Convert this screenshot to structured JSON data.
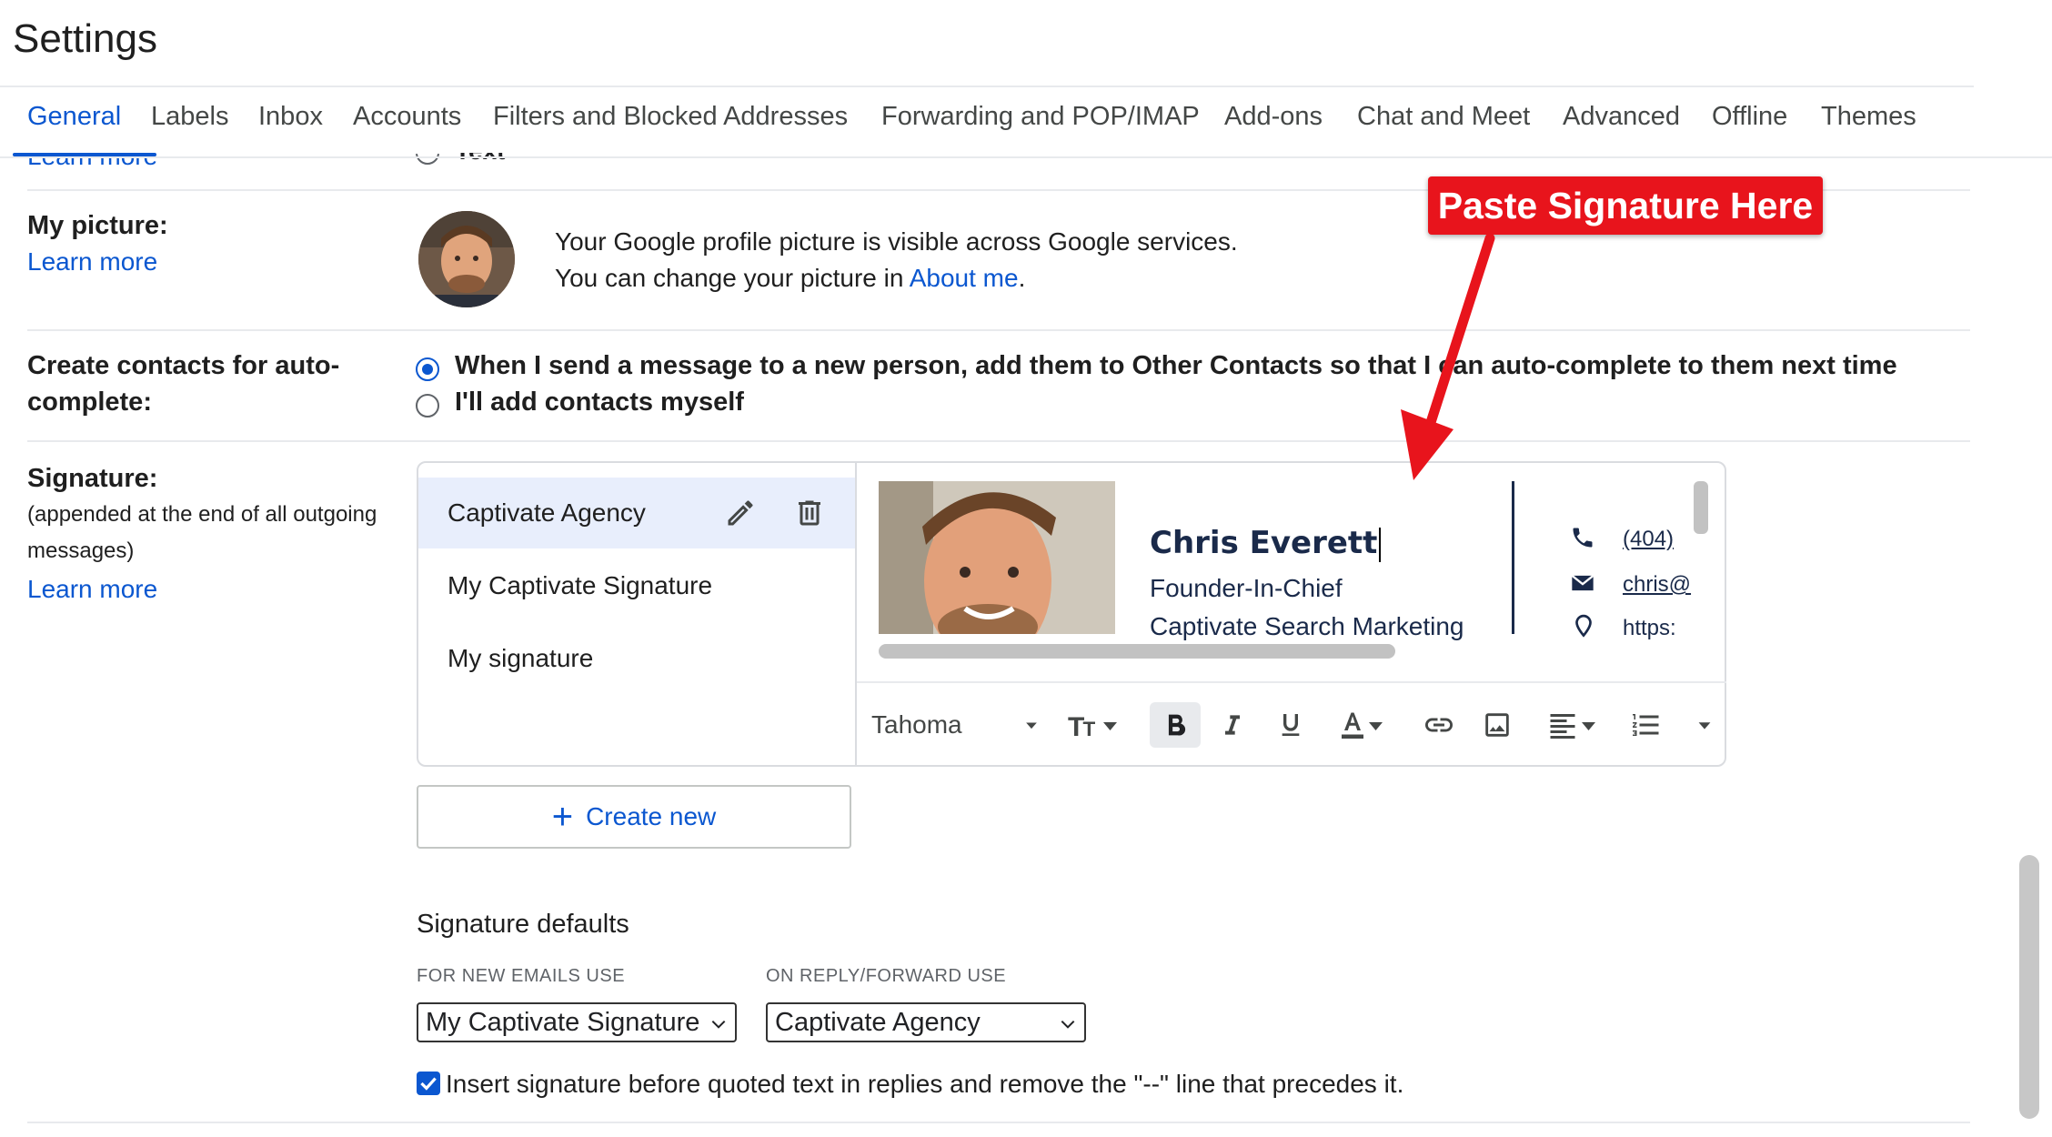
{
  "header": {
    "title": "Settings"
  },
  "tabs": [
    {
      "label": "General",
      "active": true
    },
    {
      "label": "Labels"
    },
    {
      "label": "Inbox"
    },
    {
      "label": "Accounts"
    },
    {
      "label": "Filters and Blocked Addresses"
    },
    {
      "label": "Forwarding and POP/IMAP"
    },
    {
      "label": "Add-ons"
    },
    {
      "label": "Chat and Meet"
    },
    {
      "label": "Advanced"
    },
    {
      "label": "Offline"
    },
    {
      "label": "Themes"
    }
  ],
  "partial": {
    "learn_more": "Learn more",
    "text_radio": "Text"
  },
  "my_picture": {
    "label": "My picture:",
    "learn_more": "Learn more",
    "line1": "Your Google profile picture is visible across Google services.",
    "line2_prefix": "You can change your picture in ",
    "about_me_link": "About me",
    "line2_suffix": "."
  },
  "contacts": {
    "label_line1": "Create contacts for auto-",
    "label_line2": "complete:",
    "options": [
      {
        "label": "When I send a message to a new person, add them to Other Contacts so that I can auto-complete to them next time",
        "checked": true
      },
      {
        "label": "I'll add contacts myself",
        "checked": false
      }
    ]
  },
  "signature": {
    "label": "Signature:",
    "sub_line1": "(appended at the end of all outgoing",
    "sub_line2": "messages)",
    "learn_more": "Learn more",
    "list": [
      {
        "name": "Captivate Agency",
        "selected": true
      },
      {
        "name": "My Captivate Signature"
      },
      {
        "name": "My signature"
      }
    ],
    "preview": {
      "name": "Chris Everett",
      "title": "Founder-In-Chief",
      "company": "Captivate Search Marketing",
      "phone": "(404)",
      "email": "chris@",
      "web": "https:"
    },
    "toolbar": {
      "font": "Tahoma"
    },
    "create_new": "Create new"
  },
  "defaults": {
    "heading": "Signature defaults",
    "new_label": "FOR NEW EMAILS USE",
    "new_value": "My Captivate Signature",
    "reply_label": "ON REPLY/FORWARD USE",
    "reply_value": "Captivate Agency",
    "insert_checkbox_label": "Insert signature before quoted text in replies and remove the \"--\" line that precedes it.",
    "insert_checked": true
  },
  "annotation": {
    "callout": "Paste Signature Here"
  },
  "colors": {
    "accent": "#0b57d0",
    "callout": "#e8141c",
    "selected_bg": "#e8eefc"
  }
}
